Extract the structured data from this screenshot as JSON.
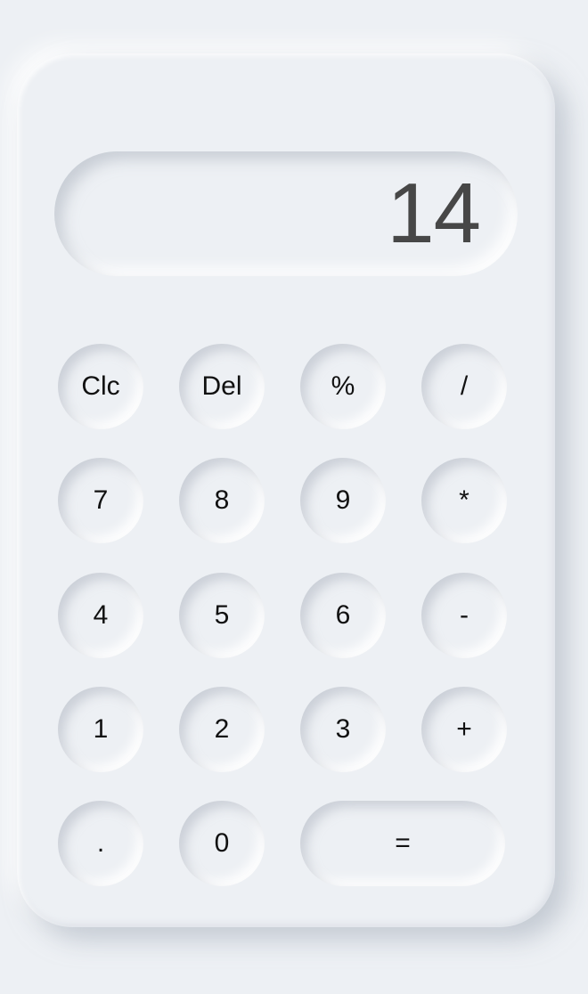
{
  "display": {
    "value": "14"
  },
  "keys": {
    "clear": "Clc",
    "delete": "Del",
    "percent": "%",
    "divide": "/",
    "seven": "7",
    "eight": "8",
    "nine": "9",
    "multiply": "*",
    "four": "4",
    "five": "5",
    "six": "6",
    "subtract": "-",
    "one": "1",
    "two": "2",
    "three": "3",
    "add": "+",
    "decimal": ".",
    "zero": "0",
    "equals": "="
  },
  "colors": {
    "background": "#edf0f4",
    "display_text": "#474747",
    "key_text": "#111111"
  }
}
